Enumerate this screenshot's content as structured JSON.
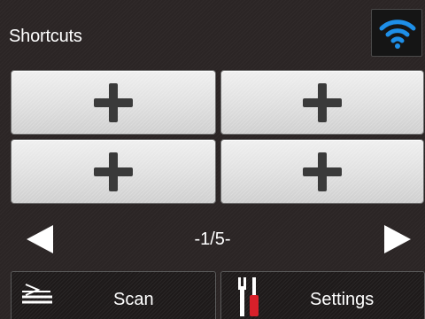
{
  "header": {
    "title": "Shortcuts",
    "wifi_icon": "wifi-icon"
  },
  "colors": {
    "background": "#2b2525",
    "tile": "#e2e2e2",
    "plus": "#3a3a3a",
    "wifi": "#1e8fe8",
    "text": "#ffffff"
  },
  "shortcuts": {
    "tiles": [
      {
        "icon": "plus-icon"
      },
      {
        "icon": "plus-icon"
      },
      {
        "icon": "plus-icon"
      },
      {
        "icon": "plus-icon"
      }
    ]
  },
  "pager": {
    "indicator": "-1/5-",
    "prev_icon": "left-arrow-icon",
    "next_icon": "right-arrow-icon"
  },
  "bottom": {
    "scan_label": "Scan",
    "settings_label": "Settings",
    "scan_icon": "scan-icon",
    "settings_icon": "tools-icon"
  }
}
